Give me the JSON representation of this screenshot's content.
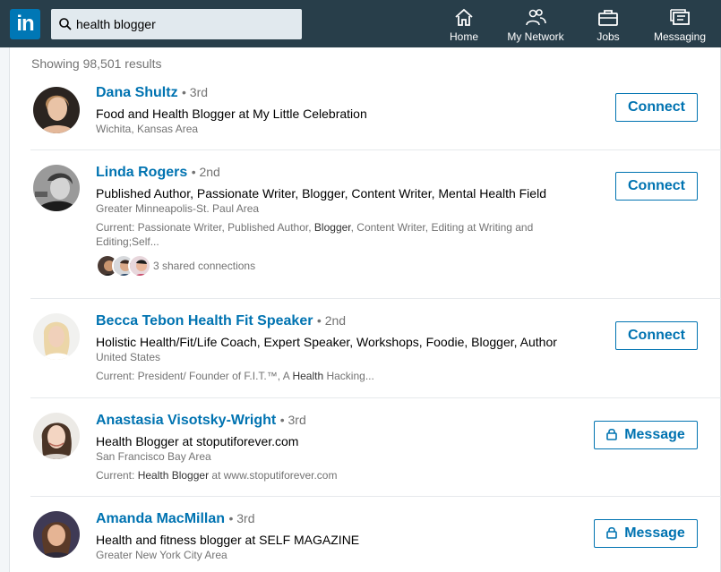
{
  "nav": {
    "logo_text": "in",
    "search_value": "health blogger",
    "items": [
      {
        "label": "Home",
        "icon": "home-icon"
      },
      {
        "label": "My Network",
        "icon": "my-network-icon"
      },
      {
        "label": "Jobs",
        "icon": "briefcase-icon"
      },
      {
        "label": "Messaging",
        "icon": "messaging-icon"
      }
    ]
  },
  "results_count": "Showing 98,501 results",
  "colors": {
    "topbar": "#283e4a",
    "accent": "#0073b1",
    "logo": "#0077b5"
  },
  "results": [
    {
      "name": "Dana Shultz",
      "degree": "• 3rd",
      "headline": "Food and Health Blogger at My Little Celebration",
      "location": "Wichita, Kansas Area",
      "action": "Connect"
    },
    {
      "name": "Linda Rogers",
      "degree": "• 2nd",
      "headline": "Published Author, Passionate Writer, Blogger, Content Writer, Mental Health Field",
      "location": "Greater Minneapolis-St. Paul Area",
      "snippet_pre": "Current: Passionate Writer, Published Author, ",
      "snippet_hl": "Blogger",
      "snippet_post": ", Content Writer, Editing at Writing and Editing;Self...",
      "shared_connections": "3 shared connections",
      "action": "Connect"
    },
    {
      "name": "Becca Tebon Health Fit Speaker",
      "degree": "• 2nd",
      "headline": "Holistic Health/Fit/Life Coach, Expert Speaker, Workshops, Foodie, Blogger, Author",
      "location": "United States",
      "snippet_pre": "Current: President/ Founder of F.I.T.™, A ",
      "snippet_hl": "Health",
      "snippet_post": " Hacking...",
      "action": "Connect"
    },
    {
      "name": "Anastasia Visotsky-Wright",
      "degree": "• 3rd",
      "headline": "Health Blogger at stoputiforever.com",
      "location": "San Francisco Bay Area",
      "snippet_pre": "Current: ",
      "snippet_hl": "Health Blogger",
      "snippet_post": " at www.stoputiforever.com",
      "action": "Message"
    },
    {
      "name": "Amanda MacMillan",
      "degree": "• 3rd",
      "headline": "Health and fitness blogger at SELF MAGAZINE",
      "location": "Greater New York City Area",
      "action": "Message"
    }
  ]
}
